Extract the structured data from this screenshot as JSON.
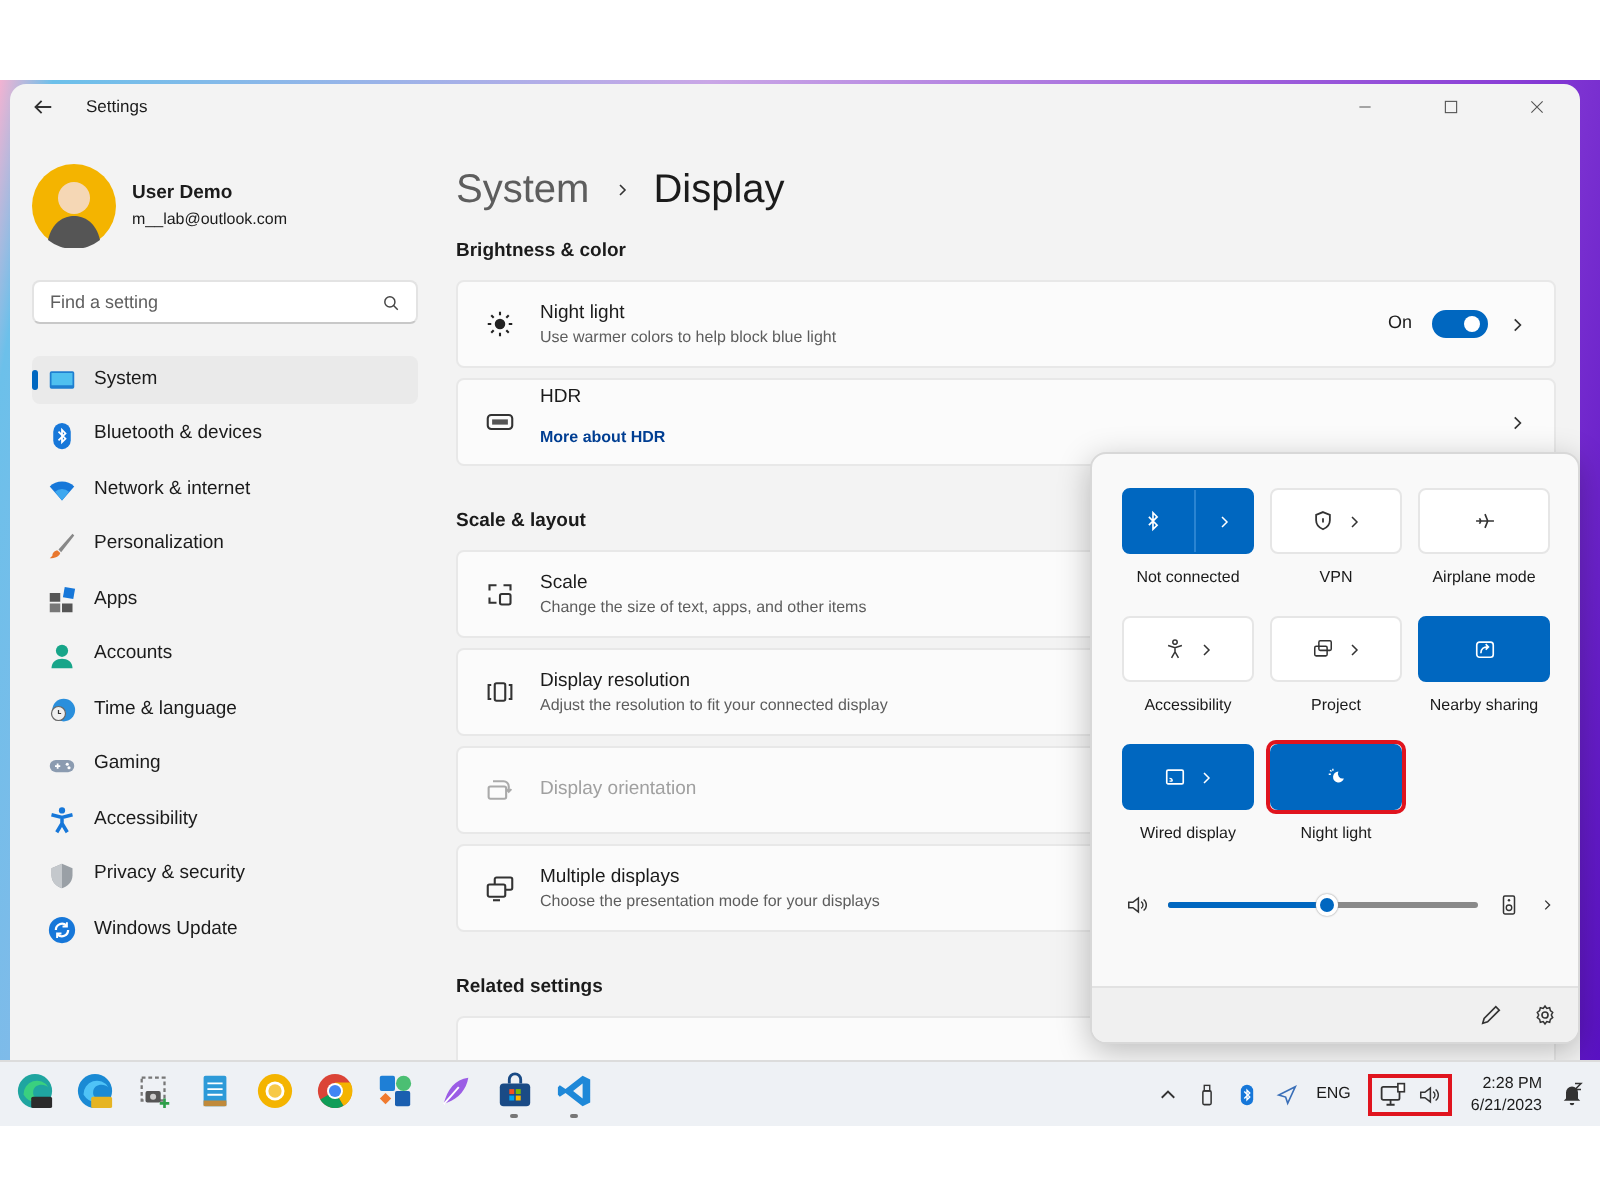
{
  "window": {
    "title": "Settings"
  },
  "user": {
    "name": "User Demo",
    "email": "m__lab@outlook.com"
  },
  "search": {
    "placeholder": "Find a setting"
  },
  "sidebar": {
    "items": [
      {
        "label": "System",
        "selected": true
      },
      {
        "label": "Bluetooth & devices",
        "selected": false
      },
      {
        "label": "Network & internet",
        "selected": false
      },
      {
        "label": "Personalization",
        "selected": false
      },
      {
        "label": "Apps",
        "selected": false
      },
      {
        "label": "Accounts",
        "selected": false
      },
      {
        "label": "Time & language",
        "selected": false
      },
      {
        "label": "Gaming",
        "selected": false
      },
      {
        "label": "Accessibility",
        "selected": false
      },
      {
        "label": "Privacy & security",
        "selected": false
      },
      {
        "label": "Windows Update",
        "selected": false
      }
    ]
  },
  "breadcrumb": {
    "parent": "System",
    "current": "Display"
  },
  "sections": [
    {
      "heading": "Brightness & color",
      "rows": [
        {
          "kind": "toggle",
          "title": "Night light",
          "subtitle": "Use warmer colors to help block blue light",
          "status": "On",
          "on": true,
          "disabled": false
        },
        {
          "kind": "link",
          "title": "HDR",
          "link": "More about HDR",
          "disabled": false
        }
      ]
    },
    {
      "heading": "Scale & layout",
      "rows": [
        {
          "kind": "plain",
          "title": "Scale",
          "subtitle": "Change the size of text, apps, and other items",
          "disabled": false
        },
        {
          "kind": "plain",
          "title": "Display resolution",
          "subtitle": "Adjust the resolution to fit your connected display",
          "disabled": false
        },
        {
          "kind": "plain",
          "title": "Display orientation",
          "disabled": true
        },
        {
          "kind": "plain",
          "title": "Multiple displays",
          "subtitle": "Choose the presentation mode for your displays",
          "disabled": false
        }
      ]
    },
    {
      "heading": "Related settings"
    }
  ],
  "quick_settings": {
    "tiles": [
      {
        "kind": "split",
        "label": "Not connected",
        "on": true,
        "highlighted": false
      },
      {
        "kind": "expand",
        "label": "VPN",
        "on": false,
        "highlighted": false
      },
      {
        "kind": "plain",
        "label": "Airplane mode",
        "on": false,
        "highlighted": false
      },
      {
        "kind": "expand",
        "label": "Accessibility",
        "on": false,
        "highlighted": false
      },
      {
        "kind": "expand",
        "label": "Project",
        "on": false,
        "highlighted": false
      },
      {
        "kind": "plain",
        "label": "Nearby sharing",
        "on": true,
        "highlighted": false
      },
      {
        "kind": "expand",
        "label": "Wired display",
        "on": true,
        "highlighted": false
      },
      {
        "kind": "plain",
        "label": "Night light",
        "on": true,
        "highlighted": true
      }
    ],
    "volume": {
      "level": 0.51
    }
  },
  "taskbar": {
    "apps": [
      {
        "running": false
      },
      {
        "running": false
      },
      {
        "running": false
      },
      {
        "running": false
      },
      {
        "running": false
      },
      {
        "running": false
      },
      {
        "running": false
      },
      {
        "running": false
      },
      {
        "running": true
      },
      {
        "running": true
      }
    ],
    "language": "ENG",
    "tray_highlighted": true,
    "time": "2:28 PM",
    "date": "6/21/2023"
  }
}
